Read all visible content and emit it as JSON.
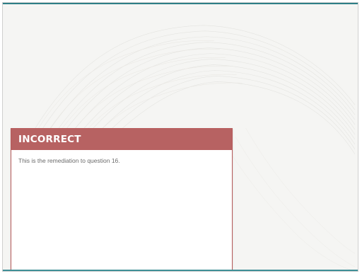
{
  "feedback": {
    "title": "INCORRECT",
    "message": "This is the remediation to question 16."
  },
  "colors": {
    "header_background": "#b76262",
    "header_text": "#ffffff",
    "body_text": "#6b6b6b",
    "page_background": "#f5f5f3",
    "accent_line": "#2e7f86"
  },
  "background_pattern": "guilloche-pattern"
}
